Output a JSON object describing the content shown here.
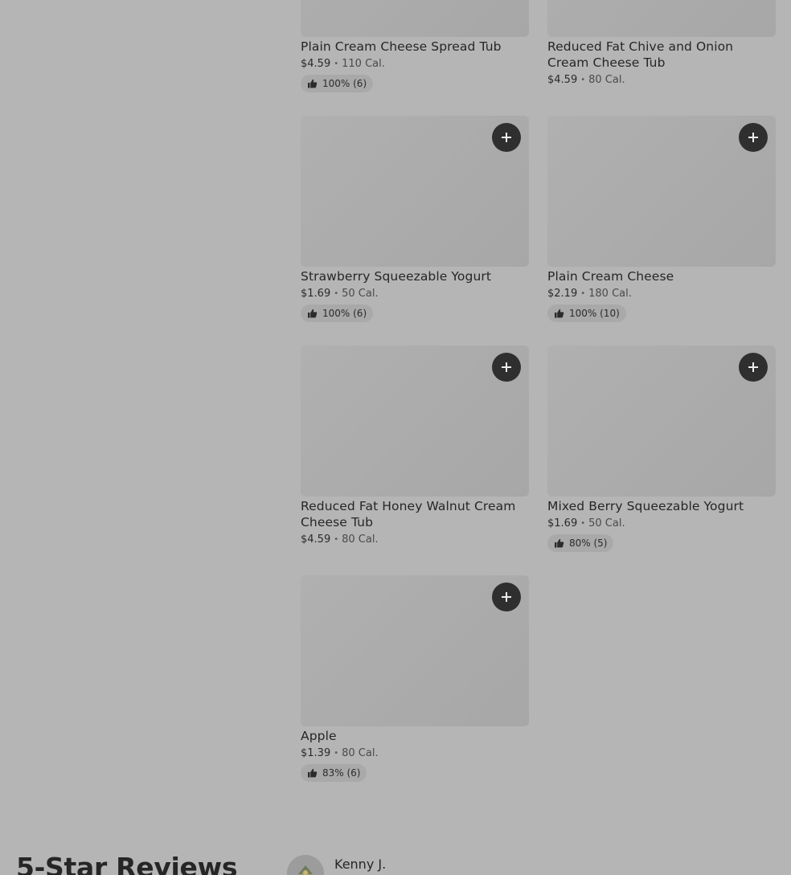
{
  "products": [
    {
      "name": "Plain Cream Cheese Spread Tub",
      "price": "$4.59",
      "calories": "110 Cal.",
      "rating": "100% (6)"
    },
    {
      "name": "Reduced Fat Chive and Onion Cream Cheese Tub",
      "price": "$4.59",
      "calories": "80 Cal.",
      "rating": null
    },
    {
      "name": "Strawberry Squeezable Yogurt",
      "price": "$1.69",
      "calories": "50 Cal.",
      "rating": "100% (6)"
    },
    {
      "name": "Plain Cream Cheese",
      "price": "$2.19",
      "calories": "180 Cal.",
      "rating": "100% (10)"
    },
    {
      "name": "Reduced Fat Honey Walnut Cream Cheese Tub",
      "price": "$4.59",
      "calories": "80 Cal.",
      "rating": null
    },
    {
      "name": "Mixed Berry Squeezable Yogurt",
      "price": "$1.69",
      "calories": "50 Cal.",
      "rating": "80% (5)"
    },
    {
      "name": "Apple",
      "price": "$1.39",
      "calories": "80 Cal.",
      "rating": "83% (6)"
    }
  ],
  "separator": "•",
  "icons": {
    "add": "plus-icon",
    "rating": "thumbs-up-icon"
  },
  "reviews": {
    "heading": "5-Star Reviews",
    "items": [
      {
        "name": "Kenny J."
      }
    ]
  },
  "colors": {
    "overlay_background": "#b5b5b5",
    "add_button": "#2f2f2f",
    "text": "#262626"
  }
}
